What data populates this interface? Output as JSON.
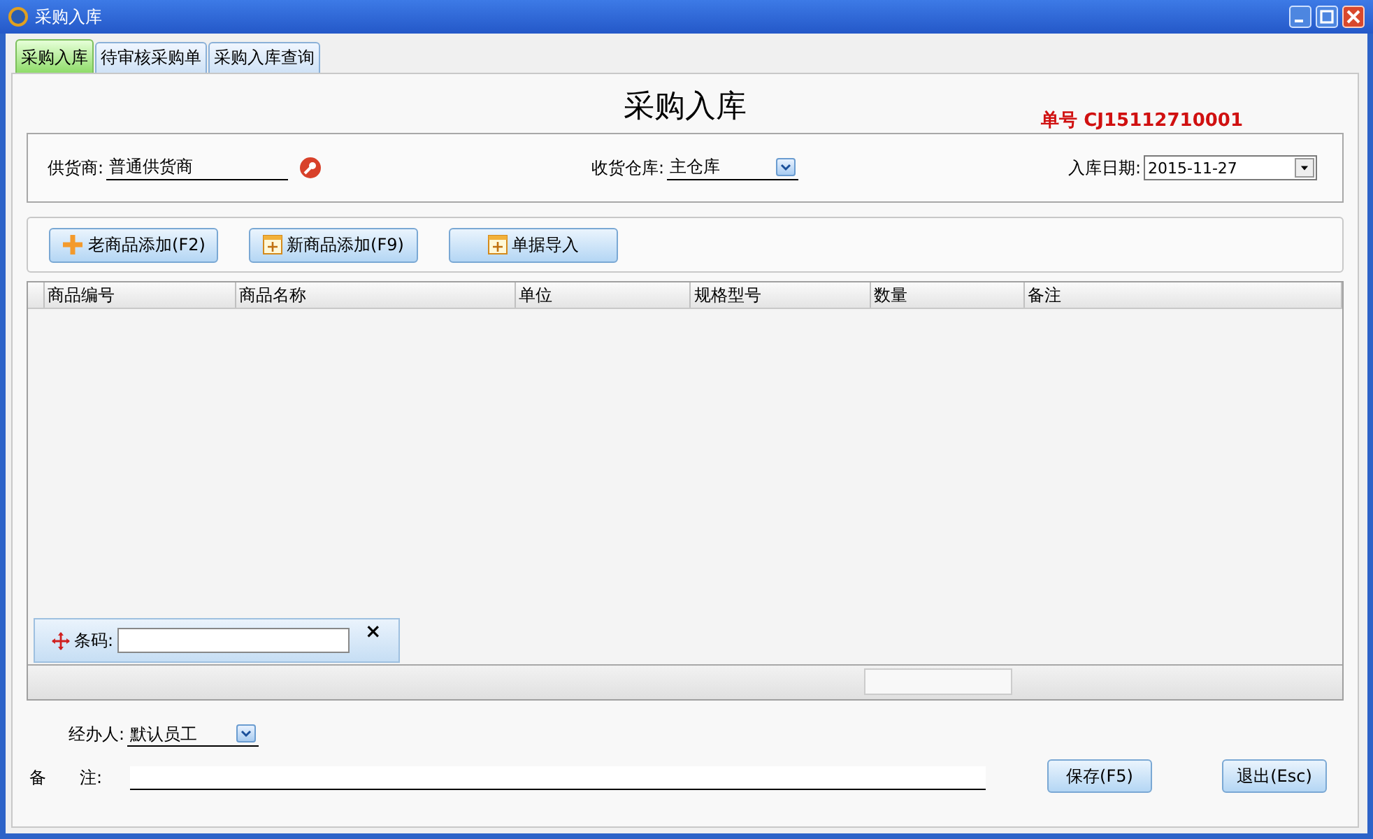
{
  "window": {
    "title": "采购入库"
  },
  "tabs": [
    {
      "label": "采购入库",
      "selected": true
    },
    {
      "label": "待审核采购单",
      "selected": false
    },
    {
      "label": "采购入库查询",
      "selected": false
    }
  ],
  "heading": "采购入库",
  "order_no": "单号 CJ15112710001",
  "header": {
    "supplier": {
      "label": "供货商:",
      "value": "普通供货商"
    },
    "warehouse": {
      "label": "收货仓库:",
      "value": "主仓库"
    },
    "date": {
      "label": "入库日期:",
      "value": "2015-11-27"
    }
  },
  "toolbar": [
    {
      "label": "老商品添加(F2)",
      "kind": "plus"
    },
    {
      "label": "新商品添加(F9)",
      "kind": "box"
    },
    {
      "label": "单据导入",
      "kind": "box"
    }
  ],
  "table": {
    "columns": [
      "商品编号",
      "商品名称",
      "单位",
      "规格型号",
      "数量",
      "备注"
    ]
  },
  "barcode": {
    "label": "条码:",
    "close": "×"
  },
  "handler": {
    "label": "经办人:",
    "value": "默认员工"
  },
  "remark": {
    "label": "备　　注:"
  },
  "buttons": [
    "保存(F5)",
    "退出(Esc)"
  ]
}
